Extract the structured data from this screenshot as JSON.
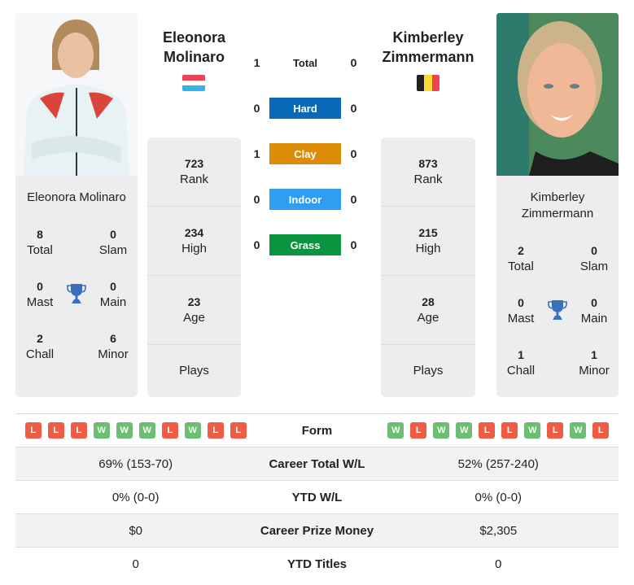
{
  "player1": {
    "name_line1": "Eleonora",
    "name_line2": "Molinaro",
    "full_name": "Eleonora Molinaro",
    "country": "Luxembourg",
    "flag_colors": [
      "#ef4155",
      "#ffffff",
      "#32b4ea"
    ],
    "titles": {
      "total": "8",
      "total_label": "Total",
      "slam": "0",
      "slam_label": "Slam",
      "mast": "0",
      "mast_label": "Mast",
      "main": "0",
      "main_label": "Main",
      "chall": "2",
      "chall_label": "Chall",
      "minor": "6",
      "minor_label": "Minor"
    },
    "stats": {
      "rank": "723",
      "rank_label": "Rank",
      "high": "234",
      "high_label": "High",
      "age": "23",
      "age_label": "Age",
      "plays_label": "Plays"
    },
    "form": [
      "L",
      "L",
      "L",
      "W",
      "W",
      "W",
      "L",
      "W",
      "L",
      "L"
    ]
  },
  "player2": {
    "name_line1": "Kimberley",
    "name_line2": "Zimmermann",
    "full_name_line1": "Kimberley",
    "full_name_line2": "Zimmermann",
    "country": "Belgium",
    "flag_colors": [
      "#222222",
      "#fdd835",
      "#ef4155"
    ],
    "titles": {
      "total": "2",
      "total_label": "Total",
      "slam": "0",
      "slam_label": "Slam",
      "mast": "0",
      "mast_label": "Mast",
      "main": "0",
      "main_label": "Main",
      "chall": "1",
      "chall_label": "Chall",
      "minor": "1",
      "minor_label": "Minor"
    },
    "stats": {
      "rank": "873",
      "rank_label": "Rank",
      "high": "215",
      "high_label": "High",
      "age": "28",
      "age_label": "Age",
      "plays_label": "Plays"
    },
    "form": [
      "W",
      "L",
      "W",
      "W",
      "L",
      "L",
      "W",
      "L",
      "W",
      "L"
    ]
  },
  "h2h": [
    {
      "label": "Total",
      "p1": "1",
      "p2": "0",
      "color": ""
    },
    {
      "label": "Hard",
      "p1": "0",
      "p2": "0",
      "color": "#0a68b8"
    },
    {
      "label": "Clay",
      "p1": "1",
      "p2": "0",
      "color": "#dc8c08"
    },
    {
      "label": "Indoor",
      "p1": "0",
      "p2": "0",
      "color": "#2e9df2"
    },
    {
      "label": "Grass",
      "p1": "0",
      "p2": "0",
      "color": "#0b9440"
    }
  ],
  "comparison": {
    "form_label": "Form",
    "rows": [
      {
        "label": "Career Total W/L",
        "p1": "69% (153-70)",
        "p2": "52% (257-240)"
      },
      {
        "label": "YTD W/L",
        "p1": "0% (0-0)",
        "p2": "0% (0-0)"
      },
      {
        "label": "Career Prize Money",
        "p1": "$0",
        "p2": "$2,305"
      },
      {
        "label": "YTD Titles",
        "p1": "0",
        "p2": "0"
      }
    ]
  },
  "colors": {
    "trophy": "#3a6fbd",
    "win": "#6dbd72",
    "loss": "#ee5c44",
    "card_bg": "#ededed"
  }
}
